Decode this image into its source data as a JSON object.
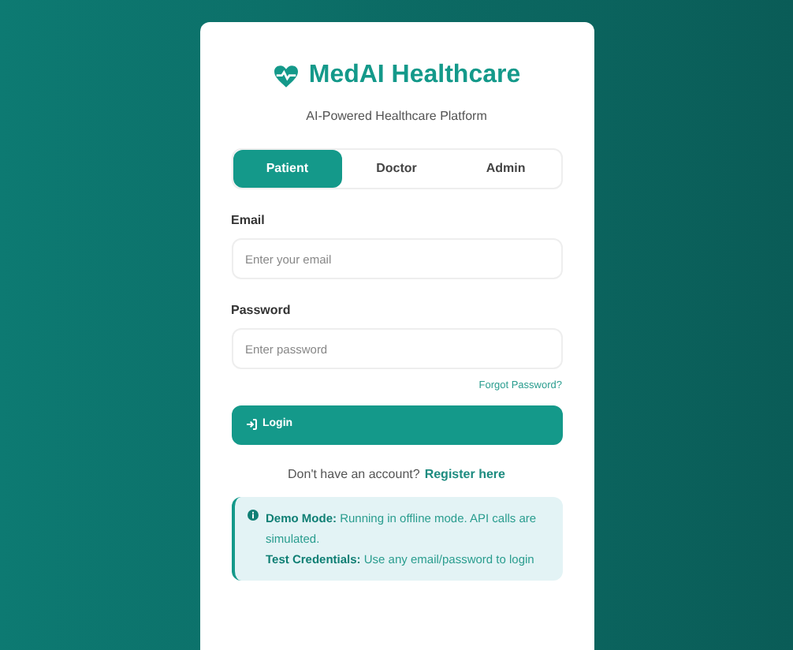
{
  "brand": {
    "title": "MedAI Healthcare",
    "subtitle": "AI-Powered Healthcare Platform"
  },
  "tabs": [
    {
      "label": "Patient",
      "selected": true
    },
    {
      "label": "Doctor",
      "selected": false
    },
    {
      "label": "Admin",
      "selected": false
    }
  ],
  "form": {
    "fields": [
      {
        "label": "Email",
        "placeholder": "Enter your email"
      },
      {
        "label": "Password",
        "placeholder": "Enter password"
      }
    ],
    "forgot_link": "Forgot Password?",
    "login_button": "Login"
  },
  "register": {
    "prompt": "Don't have an account?",
    "link": "Register here"
  },
  "notice": {
    "lines": [
      "**Demo Mode:** Running in offline mode. API calls are simulated.",
      "**Test Credentials:** Use any email/password to login"
    ]
  }
}
